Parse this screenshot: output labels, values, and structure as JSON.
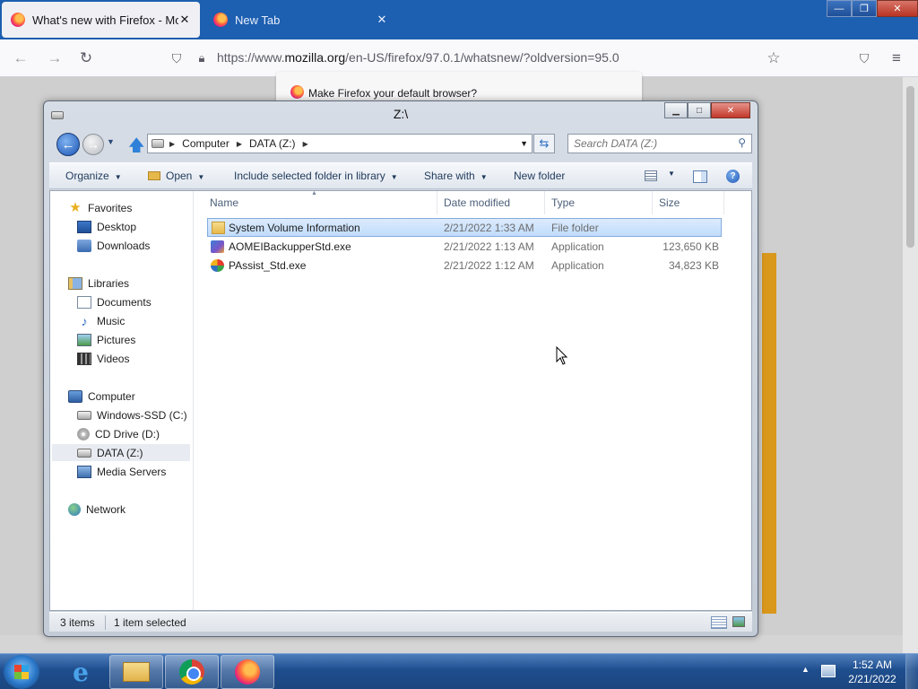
{
  "firefox": {
    "tabs": [
      {
        "title": "What's new with Firefox - More",
        "close": "✕"
      },
      {
        "title": "New Tab",
        "close": "✕"
      }
    ],
    "url_prefix": "https://www.",
    "url_domain": "mozilla.org",
    "url_path": "/en-US/firefox/97.0.1/whatsnew/?oldversion=95.0",
    "notification": "Make Firefox your default browser?"
  },
  "explorer": {
    "title": "Z:\\",
    "breadcrumb": [
      "Computer",
      "DATA (Z:)"
    ],
    "search_placeholder": "Search DATA (Z:)",
    "toolbar": {
      "organize": "Organize",
      "open": "Open",
      "include": "Include selected folder in library",
      "share": "Share with",
      "new_folder": "New folder"
    },
    "nav": {
      "favorites": "Favorites",
      "desktop": "Desktop",
      "downloads": "Downloads",
      "libraries": "Libraries",
      "documents": "Documents",
      "music": "Music",
      "pictures": "Pictures",
      "videos": "Videos",
      "computer": "Computer",
      "windows_ssd": "Windows-SSD (C:)",
      "cd_drive": "CD Drive (D:)",
      "data_z": "DATA (Z:)",
      "media_servers": "Media Servers",
      "network": "Network"
    },
    "columns": {
      "name": "Name",
      "date": "Date modified",
      "type": "Type",
      "size": "Size"
    },
    "files": [
      {
        "name": "System Volume Information",
        "date": "2/21/2022 1:33 AM",
        "type": "File folder",
        "size": ""
      },
      {
        "name": "AOMEIBackupperStd.exe",
        "date": "2/21/2022 1:13 AM",
        "type": "Application",
        "size": "123,650 KB"
      },
      {
        "name": "PAssist_Std.exe",
        "date": "2/21/2022 1:12 AM",
        "type": "Application",
        "size": "34,823 KB"
      }
    ],
    "status": {
      "count": "3 items",
      "selected": "1 item selected"
    }
  },
  "taskbar": {
    "time": "1:52 AM",
    "date": "2/21/2022"
  }
}
